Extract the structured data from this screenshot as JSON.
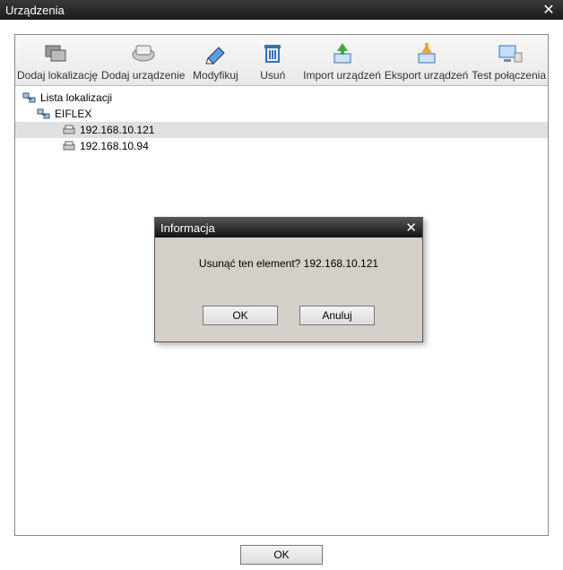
{
  "window": {
    "title": "Urządzenia"
  },
  "toolbar": {
    "add_location": "Dodaj lokalizację",
    "add_device": "Dodaj urządzenie",
    "modify": "Modyfikuj",
    "delete": "Usuń",
    "import": "Import urządzeń",
    "export": "Eksport urządzeń",
    "test": "Test połączenia"
  },
  "tree": {
    "root": "Lista lokalizacji",
    "location": "EIFLEX",
    "devices": [
      "192.168.10.121",
      "192.168.10.94"
    ]
  },
  "dialog": {
    "title": "Informacja",
    "message": "Usunąć ten element? 192.168.10.121",
    "ok": "OK",
    "cancel": "Anuluj"
  },
  "buttons": {
    "ok": "OK"
  }
}
